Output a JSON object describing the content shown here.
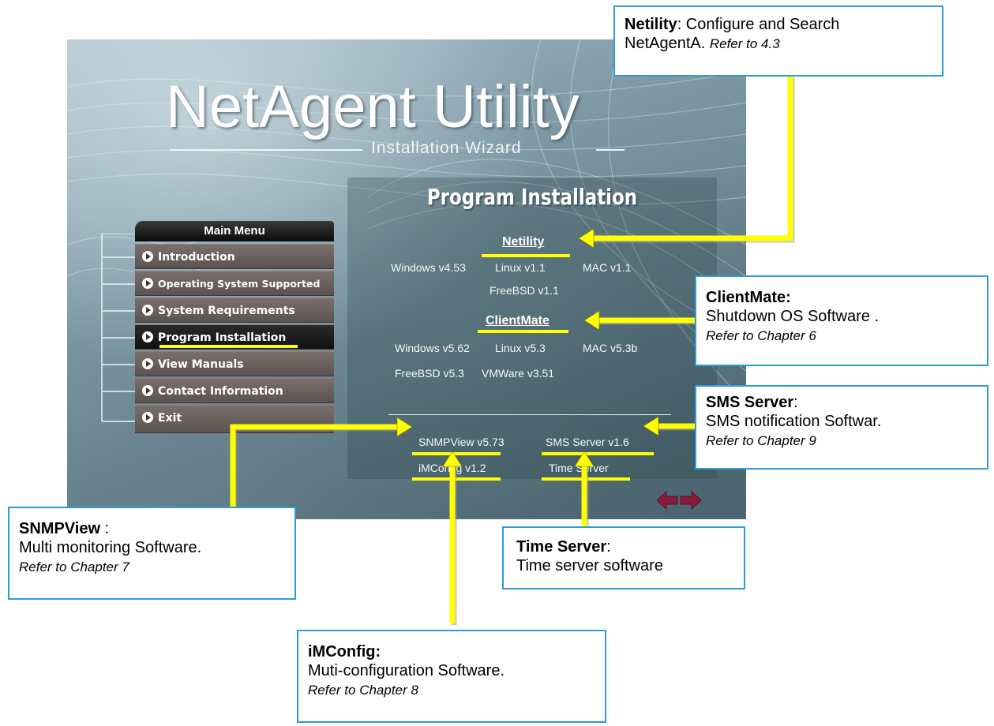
{
  "window": {
    "title_main": "NetAgent Utility",
    "title_sub": "Installation Wizard"
  },
  "menu": {
    "header": "Main Menu",
    "items": [
      {
        "label": "Introduction"
      },
      {
        "label": "Operating System Supported"
      },
      {
        "label": "System Requirements"
      },
      {
        "label": "Program Installation",
        "active": true
      },
      {
        "label": "View Manuals"
      },
      {
        "label": "Contact Information"
      },
      {
        "label": "Exit"
      }
    ]
  },
  "panel": {
    "title": "Program Installation",
    "netility": {
      "title": "Netility",
      "links": [
        "Windows v4.53",
        "Linux v1.1",
        "MAC v1.1",
        "FreeBSD v1.1"
      ]
    },
    "clientmate": {
      "title": "ClientMate",
      "links": [
        "Windows v5.62",
        "Linux v5.3",
        "MAC v5.3b",
        "FreeBSD v5.3",
        "VMWare v3.51"
      ]
    },
    "tools": {
      "snmpview": "SNMPView v5.73",
      "sms_server": "SMS Server v1.6",
      "imconfig": "iMConfig v1.2",
      "time_server": "Time Server"
    }
  },
  "callouts": {
    "netility": {
      "bold": "Netility",
      "text1": ": Configure and Search",
      "text2": "NetAgentA. ",
      "ref": "Refer to 4.3"
    },
    "clientmate": {
      "bold": "ClientMate:",
      "text": "Shutdown OS Software .",
      "ref": "Refer to Chapter 6"
    },
    "sms": {
      "bold": "SMS Server",
      "colon": ":",
      "text": "SMS notification Softwar.",
      "ref": "Refer to Chapter 9"
    },
    "snmpview": {
      "bold": "SNMPView",
      "colon": " :",
      "text": "Multi monitoring Software.",
      "ref": "Refer to Chapter 7"
    },
    "timeserver": {
      "bold": "Time Server",
      "colon": ":",
      "text": "Time server software"
    },
    "imconfig": {
      "bold": "iMConfig:",
      "text": "Muti-configuration Software.",
      "ref": "Refer to Chapter 8"
    }
  },
  "colors": {
    "accent_yellow": "#ffff00",
    "callout_border": "#2e9bd6",
    "menu_bg": "#6b605d"
  }
}
